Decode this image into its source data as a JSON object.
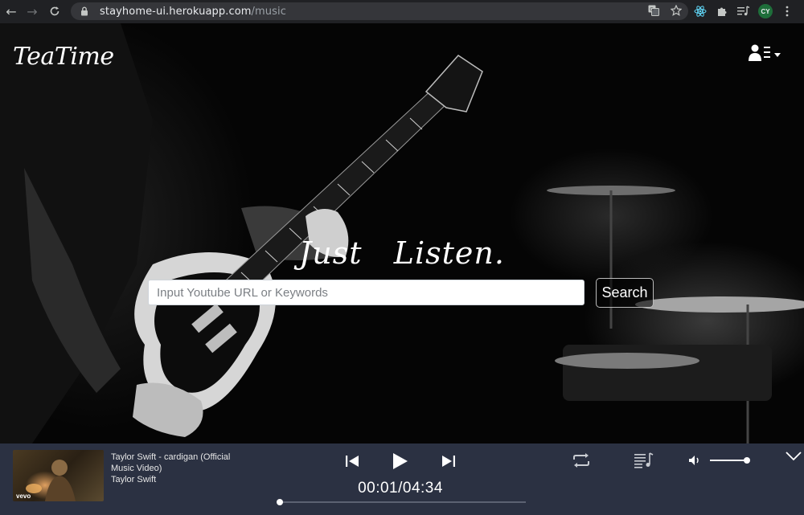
{
  "browser": {
    "url_host": "stayhome-ui.herokuapp.com",
    "url_path": "/music",
    "profile_initials": "CY"
  },
  "app": {
    "logo": "TeaTime",
    "headline": "Just   Listen.",
    "search": {
      "placeholder": "Input Youtube URL or Keywords",
      "value": "",
      "button_label": "Search"
    }
  },
  "player": {
    "track_title": "Taylor Swift - cardigan (Official Music Video)",
    "artist": "Taylor Swift",
    "thumbnail_badge": "vevo",
    "elapsed_display": "00:01/04:34",
    "progress_fraction": 0.004,
    "volume_fraction": 0.96
  },
  "colors": {
    "player_bg": "#2b3142",
    "chrome_bg": "#202124",
    "omnibox_bg": "#35363a"
  }
}
